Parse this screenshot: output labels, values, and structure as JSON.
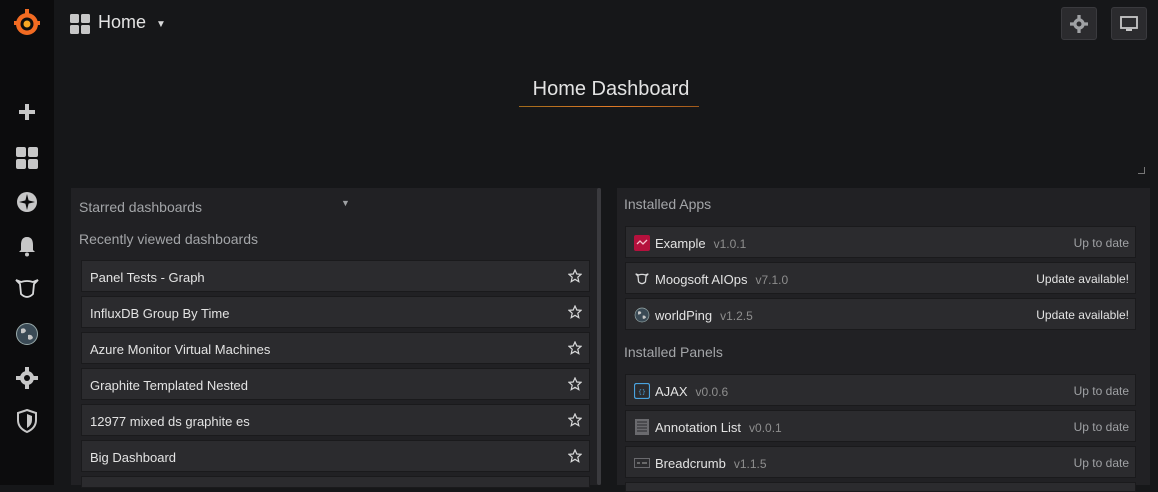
{
  "topbar": {
    "title": "Home"
  },
  "hero": {
    "title": "Home Dashboard"
  },
  "starred": {
    "heading": "Starred dashboards"
  },
  "recent": {
    "heading": "Recently viewed dashboards",
    "items": [
      {
        "name": "Panel Tests - Graph"
      },
      {
        "name": "InfluxDB Group By Time"
      },
      {
        "name": "Azure Monitor Virtual Machines"
      },
      {
        "name": "Graphite Templated Nested"
      },
      {
        "name": "12977 mixed ds graphite es"
      },
      {
        "name": "Big Dashboard"
      }
    ]
  },
  "apps": {
    "heading": "Installed Apps",
    "items": [
      {
        "name": "Example",
        "version": "v1.0.1",
        "status": "Up to date",
        "icon": "example-app-icon"
      },
      {
        "name": "Moogsoft AIOps",
        "version": "v7.1.0",
        "status": "Update available!",
        "icon": "moogsoft-icon"
      },
      {
        "name": "worldPing",
        "version": "v1.2.5",
        "status": "Update available!",
        "icon": "globe-icon"
      }
    ]
  },
  "panels": {
    "heading": "Installed Panels",
    "items": [
      {
        "name": "AJAX",
        "version": "v0.0.6",
        "status": "Up to date",
        "icon": "ajax-icon"
      },
      {
        "name": "Annotation List",
        "version": "v0.0.1",
        "status": "Up to date",
        "icon": "annotation-list-icon"
      },
      {
        "name": "Breadcrumb",
        "version": "v1.1.5",
        "status": "Up to date",
        "icon": "breadcrumb-icon"
      }
    ]
  },
  "colors": {
    "accent": "#e07a27",
    "background": "#161719",
    "panel": "#212124"
  }
}
